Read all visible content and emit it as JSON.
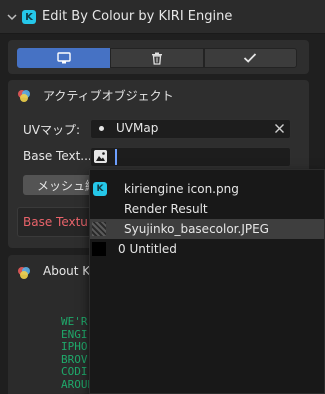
{
  "header": {
    "title": "Edit By Colour by KIRI Engine",
    "logo_glyph": "K"
  },
  "toolbar": {
    "buttons": [
      {
        "icon": "monitor-icon",
        "active": true
      },
      {
        "icon": "trash-icon",
        "active": false
      },
      {
        "icon": "checkmark-icon",
        "active": false
      }
    ],
    "active_color": "#4672c4"
  },
  "active_object_panel": {
    "title": "アクティブオブジェクト",
    "uv_map": {
      "label": "UVマップ:",
      "value": "UVMap"
    },
    "base_texture": {
      "label": "Base Text..."
    },
    "mesh_button_label": "メッシュ編",
    "error_text": "Base Texture"
  },
  "about_panel": {
    "title": "About KI",
    "lines": [
      "WE'R",
      "ENGI",
      "IPHO",
      "BROV",
      "CODI",
      "AROUN"
    ]
  },
  "texture_popup": {
    "items": [
      {
        "label": "kiriengine icon.png",
        "thumb": "kiri-logo"
      },
      {
        "label": "Render Result",
        "thumb": "none"
      },
      {
        "label": "Syujinko_basecolor.JPEG",
        "thumb": "noise-texture",
        "selected": true
      },
      {
        "label": "0 Untitled",
        "thumb": "black"
      }
    ]
  },
  "colors": {
    "error": "#e8636a",
    "kiri_cyan": "#25c7e9",
    "about_text": "#1fa86a"
  }
}
